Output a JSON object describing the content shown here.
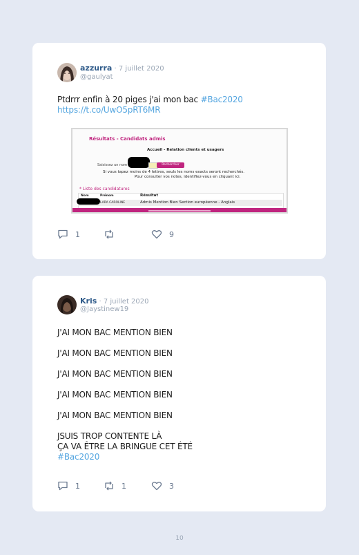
{
  "tweets": [
    {
      "name": "azzurra",
      "date": " · 7 juillet 2020",
      "handle": "@gaulyat",
      "text": "Ptdrrr enfin à 20 piges j'ai mon bac ",
      "hashtag": "#Bac2020",
      "link": "https://t.co/UwO5pRT6MR",
      "replies": "1",
      "retweets": "",
      "likes": "9",
      "embedded_image": {
        "header": "Résultats - Candidats admis",
        "title": "Accueil - Relation clients et usagers",
        "search_label": "Saisissez un nom :",
        "search_button": "Rechercher",
        "instruction1": "Si vous tapez moins de 4 lettres, seuls les noms exacts seront recherchés.",
        "instruction2": "Pour consulter vos notes, identifiez-vous en cliquant ici.",
        "list_title": "* Liste des candidatures",
        "col_name": "Nom",
        "col_firstname": "Prénom",
        "col_result": "Résultat",
        "row_firstname": "LARA CAROLINE",
        "row_result": "Admis Mention Bien Section européenne - Anglais"
      }
    },
    {
      "name": "Kris",
      "date": " · 7 juillet 2020",
      "handle": "@Jaystinew19",
      "lines": [
        "J'AI MON BAC MENTION BIEN",
        "J'AI MON BAC MENTION BIEN",
        "J'AI MON BAC MENTION BIEN",
        "J'AI MON BAC MENTION BIEN",
        "J'AI MON BAC MENTION BIEN",
        "JSUIS TROP CONTENTE LÀ",
        "ÇA VA ÊTRE LA BRINGUE CET ÉTÉ"
      ],
      "hashtag": "#Bac2020",
      "replies": "1",
      "retweets": "1",
      "likes": "3"
    }
  ],
  "page_number": "10",
  "colors": {
    "background": "#e4e9f3",
    "link": "#55a6e0",
    "name": "#2f5b8a",
    "magenta": "#c0257f"
  },
  "icons": [
    "reply-icon",
    "retweet-icon",
    "like-icon"
  ]
}
